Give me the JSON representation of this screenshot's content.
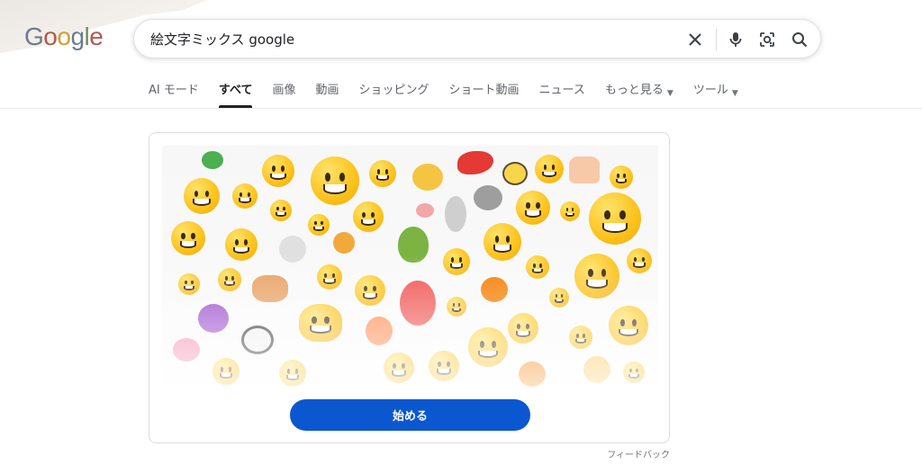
{
  "logo": {
    "text": "Google"
  },
  "search": {
    "query": "絵文字ミックス google",
    "icons": [
      "close-icon",
      "microphone-icon",
      "lens-icon",
      "search-icon"
    ]
  },
  "tabs": [
    {
      "label": "AI モード"
    },
    {
      "label": "すべて",
      "active": true
    },
    {
      "label": "画像"
    },
    {
      "label": "動画"
    },
    {
      "label": "ショッピング"
    },
    {
      "label": "ショート動画"
    },
    {
      "label": "ニュース"
    },
    {
      "label": "もっと見る",
      "dropdown": true
    },
    {
      "label": "ツール",
      "dropdown": true
    }
  ],
  "card": {
    "button_label": "始める",
    "feedback_label": "フィードバック"
  },
  "colors": {
    "accent": "#0b57d0",
    "emoji": "#fcc21b",
    "text_secondary": "#5f6368"
  }
}
